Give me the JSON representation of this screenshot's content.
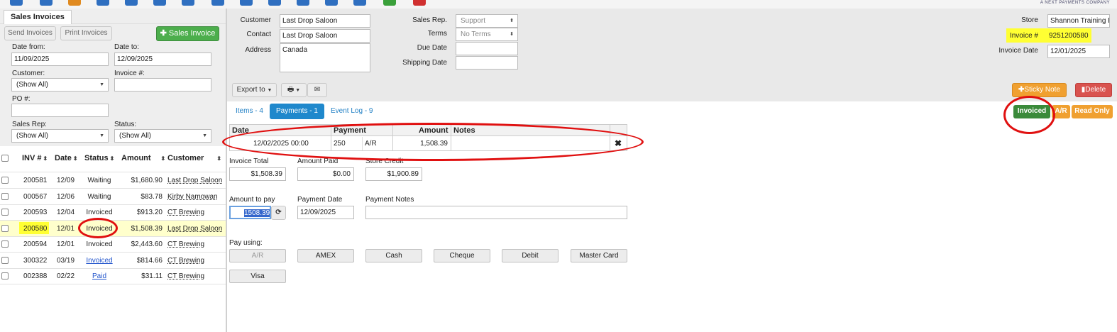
{
  "colors": {
    "accent": "#1f88cc",
    "green": "#4cae4c",
    "highlight": "#ffff33",
    "invoiced": "#3a8a3a",
    "orange": "#f0a030",
    "red": "#d9534f",
    "annotation": "#e01010"
  },
  "toolbar": {
    "icons": [
      "cart-icon",
      "phone-icon",
      "chart-icon",
      "list-icon",
      "list-icon",
      "list-icon",
      "calculator-icon",
      "check-icon",
      "document-icon",
      "refresh-icon",
      "user-icon",
      "badge-icon",
      "badge-icon",
      "badge-green-icon",
      "badge-red-icon"
    ],
    "brand": "A NEXT PAYMENTS COMPANY"
  },
  "left": {
    "tab_label": "Sales Invoices",
    "send_invoices": "Send Invoices",
    "print_invoices": "Print Invoices",
    "new_sales_invoice": "Sales Invoice",
    "date_from_label": "Date from:",
    "date_from_value": "11/09/2025",
    "date_to_label": "Date to:",
    "date_to_value": "12/09/2025",
    "customer_label": "Customer:",
    "customer_value": "(Show All)",
    "invoice_label": "Invoice #:",
    "invoice_value": "",
    "po_label": "PO #:",
    "po_value": "",
    "salesrep_label": "Sales Rep:",
    "salesrep_value": "(Show All)",
    "status_label": "Status:",
    "status_value": "(Show All)",
    "columns": [
      "INV #",
      "Date",
      "Status",
      "Amount",
      "Customer"
    ],
    "rows": [
      {
        "inv": "200581",
        "date": "12/09",
        "status": "Waiting",
        "amount": "$1,680.90",
        "customer": "Last Drop Saloon",
        "selected": false,
        "status_link": false
      },
      {
        "inv": "000567",
        "date": "12/06",
        "status": "Waiting",
        "amount": "$83.78",
        "customer": "Kirby Namowan",
        "selected": false,
        "status_link": false
      },
      {
        "inv": "200593",
        "date": "12/04",
        "status": "Invoiced",
        "amount": "$913.20",
        "customer": "CT Brewing",
        "selected": false,
        "status_link": false
      },
      {
        "inv": "200580",
        "date": "12/01",
        "status": "Invoiced",
        "amount": "$1,508.39",
        "customer": "Last Drop Saloon",
        "selected": true,
        "status_link": false
      },
      {
        "inv": "200594",
        "date": "12/01",
        "status": "Invoiced",
        "amount": "$2,443.60",
        "customer": "CT Brewing",
        "selected": false,
        "status_link": false
      },
      {
        "inv": "300322",
        "date": "03/19",
        "status": "Invoiced",
        "amount": "$814.66",
        "customer": "CT Brewing",
        "selected": false,
        "status_link": true
      },
      {
        "inv": "002388",
        "date": "02/22",
        "status": "Paid",
        "amount": "$31.11",
        "customer": "CT Brewing",
        "selected": false,
        "status_link": true
      }
    ]
  },
  "header": {
    "customer_label": "Customer",
    "customer_value": "Last Drop Saloon",
    "contact_label": "Contact",
    "contact_value": "Last Drop Saloon",
    "address_label": "Address",
    "address_value": "Canada",
    "salesrep_label": "Sales Rep.",
    "salesrep_value": "Support",
    "terms_label": "Terms",
    "terms_value": "No Terms",
    "duedate_label": "Due Date",
    "duedate_value": "",
    "shipdate_label": "Shipping Date",
    "shipdate_value": "",
    "store_label": "Store",
    "store_value": "Shannon Training F",
    "invoice_no_label": "Invoice #",
    "invoice_no_value": "9251200580",
    "invoice_date_label": "Invoice Date",
    "invoice_date_value": "12/01/2025"
  },
  "actions": {
    "export_to": "Export to",
    "sticky_note": "Sticky Note",
    "delete": "Delete",
    "badge_invoiced": "Invoiced",
    "badge_ar": "A/R",
    "badge_readonly": "Read Only"
  },
  "tabs": [
    {
      "label": "Items - 4",
      "active": false
    },
    {
      "label": "Payments - 1",
      "active": true
    },
    {
      "label": "Event Log - 9",
      "active": false
    }
  ],
  "payments_grid": {
    "columns": [
      "Date",
      "Payment",
      "Amount",
      "Notes"
    ],
    "rows": [
      {
        "date": "12/02/2025 00:00",
        "payment": "250",
        "method": "A/R",
        "amount": "1,508.39",
        "notes": ""
      }
    ]
  },
  "totals": {
    "invoice_total_label": "Invoice Total",
    "invoice_total_value": "$1,508.39",
    "amount_paid_label": "Amount Paid",
    "amount_paid_value": "$0.00",
    "store_credit_label": "Store Credit",
    "store_credit_value": "$1,900.89"
  },
  "payment_entry": {
    "amount_label": "Amount to pay",
    "amount_value": "1508.39",
    "date_label": "Payment Date",
    "date_value": "12/09/2025",
    "notes_label": "Payment Notes",
    "notes_value": ""
  },
  "pay_using": {
    "label": "Pay using:",
    "methods": [
      "A/R",
      "AMEX",
      "Cash",
      "Cheque",
      "Debit",
      "Master Card",
      "Visa"
    ]
  }
}
